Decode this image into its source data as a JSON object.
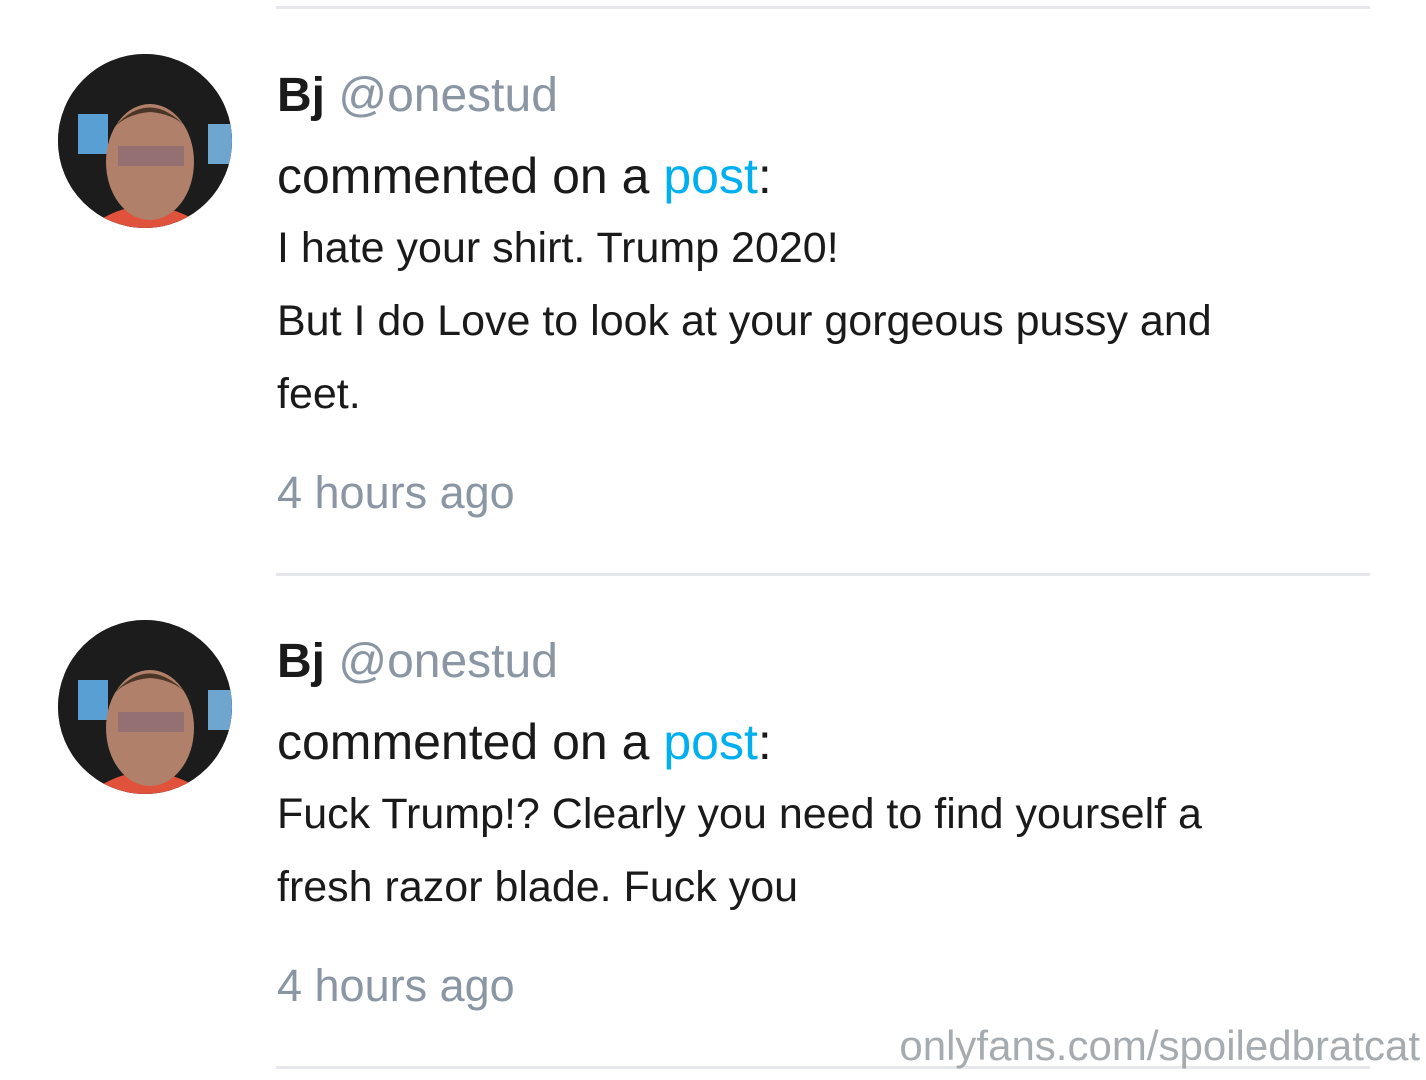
{
  "comments": [
    {
      "display_name": "Bj",
      "handle": "@onestud",
      "action_text": "commented on a ",
      "post_link": "post",
      "colon": ":",
      "text_lines": [
        "I hate your shirt. Trump 2020!",
        "But I do Love to look at your gorgeous pussy and",
        "feet."
      ],
      "timestamp": "4 hours ago"
    },
    {
      "display_name": "Bj",
      "handle": "@onestud",
      "action_text": "commented on a ",
      "post_link": "post",
      "colon": ":",
      "text_lines": [
        "Fuck Trump!? Clearly you need to find yourself a",
        "fresh razor blade. Fuck you"
      ],
      "timestamp": "4 hours ago"
    }
  ],
  "watermark": "onlyfans.com/spoiledbratcat",
  "colors": {
    "accent_link": "#00aff0",
    "muted_text": "#8a96a3",
    "divider": "#e6e8eb"
  },
  "icons": {
    "avatar": "user-avatar-photo"
  }
}
